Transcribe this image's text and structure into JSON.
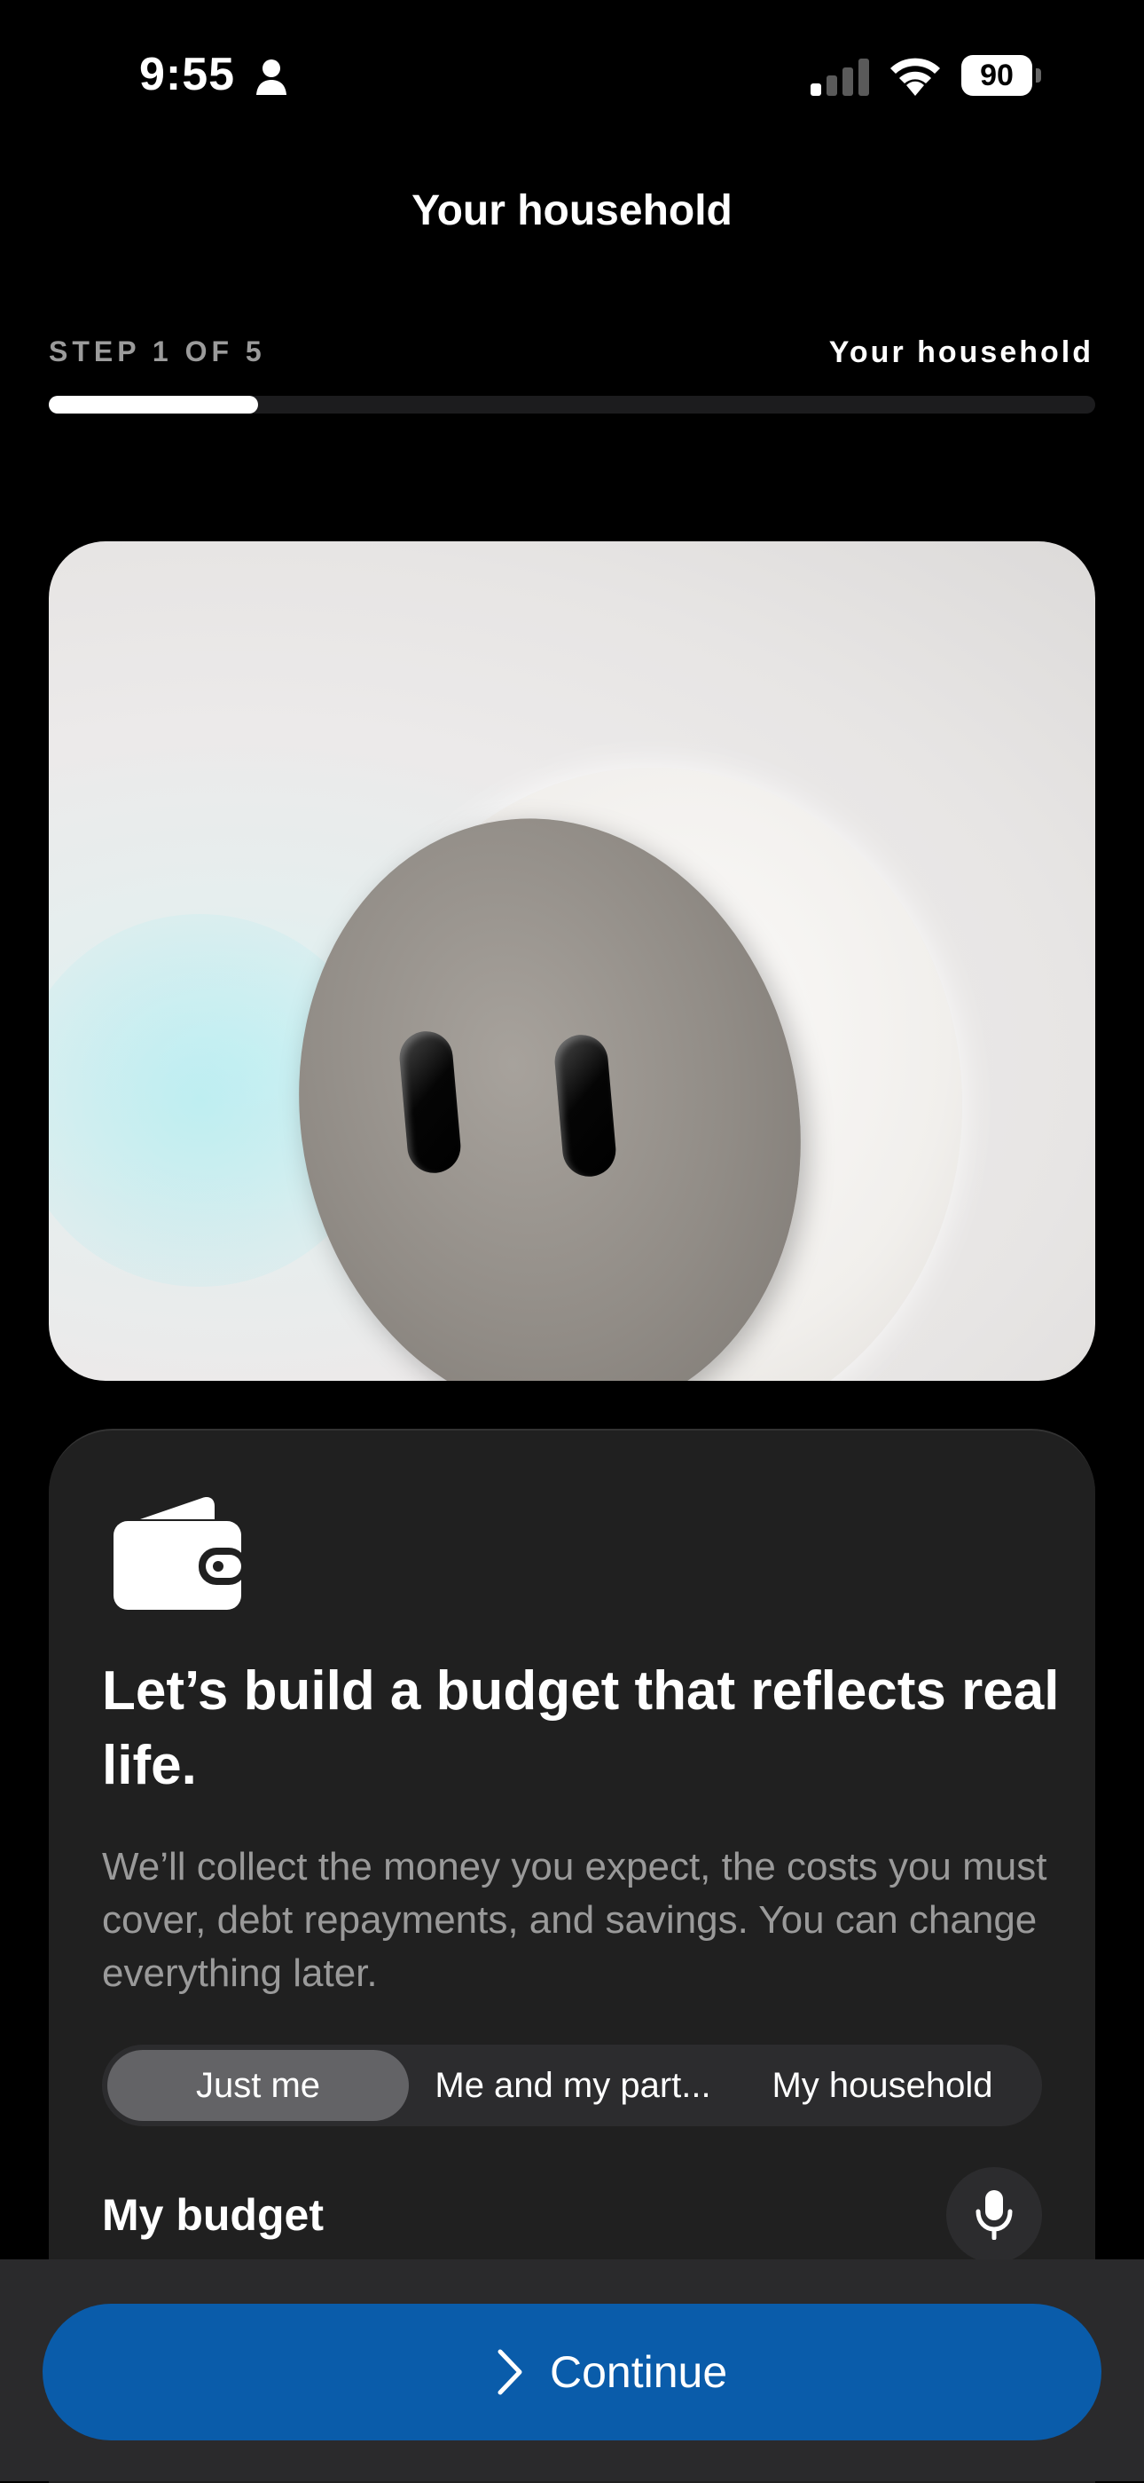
{
  "status_bar": {
    "time": "9:55",
    "battery": "90",
    "icons": [
      "person-icon",
      "cellular-signal-icon",
      "wifi-icon",
      "battery-icon"
    ]
  },
  "header": {
    "title": "Your household"
  },
  "progress": {
    "step_label": "STEP 1 OF 5",
    "step_name": "Your household",
    "fraction": 0.2
  },
  "hero": {
    "image": "robot-illustration"
  },
  "card": {
    "icon": "wallet-icon",
    "title": "Let’s build a budget that reflects real life.",
    "description": "We’ll collect the money you expect, the costs you must cover, debt repayments, and savings. You can change everything later.",
    "segments": [
      {
        "label": "Just me",
        "selected": true
      },
      {
        "label": "Me and my part...",
        "selected": false
      },
      {
        "label": "My household",
        "selected": false
      }
    ],
    "section_label": "My budget",
    "mic_icon": "microphone-icon"
  },
  "footer": {
    "continue_label": "Continue",
    "continue_icon": "chevron-right-icon"
  },
  "colors": {
    "background": "#000000",
    "card": "#202020",
    "accent": "#0a5caa",
    "segment_selected": "#636366"
  }
}
